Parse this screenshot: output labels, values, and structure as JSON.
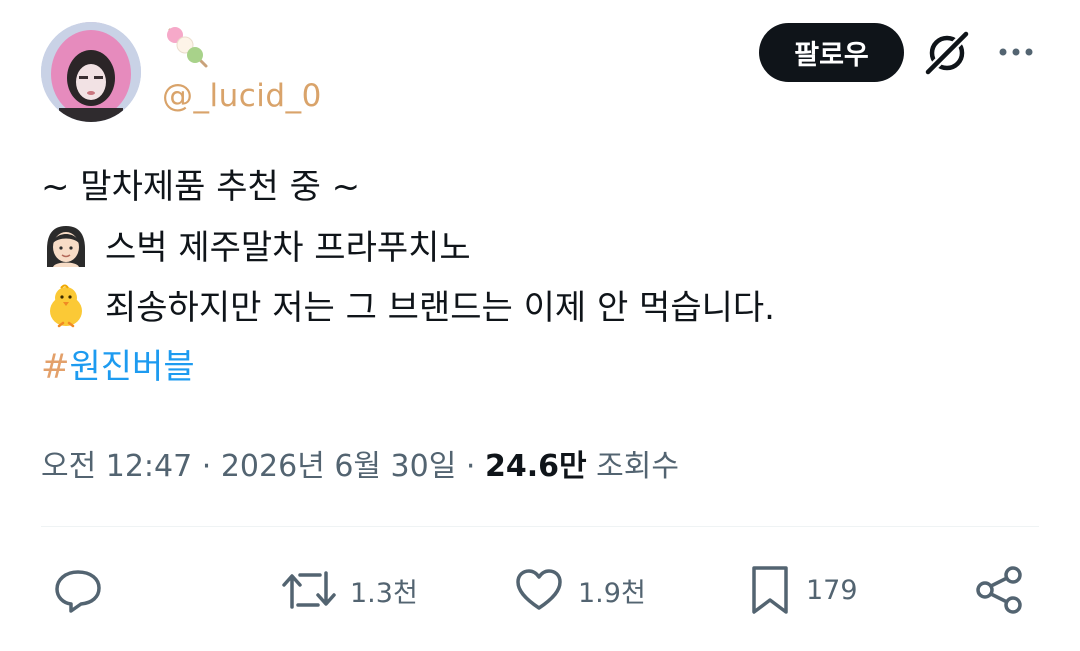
{
  "header": {
    "handle": "@_lucid_0",
    "follow_label": "팔로우",
    "name_emoji": "dango-icon"
  },
  "tweet": {
    "line1": "~ 말차제품 추천 중 ~",
    "line2": "스벅 제주말차 프라푸치노",
    "line3": "죄송하지만 저는 그 브랜드는 이제 안 먹습니다.",
    "hashtag_symbol": "#",
    "hashtag_text": "원진버블"
  },
  "meta": {
    "time": "오전 12:47",
    "separator": "·",
    "date": "2026년 6월 30일",
    "views_count": "24.6만",
    "views_label": "조회수"
  },
  "actions": {
    "retweets": "1.3천",
    "likes": "1.9천",
    "bookmarks": "179"
  },
  "colors": {
    "accent": "#1d9bf0",
    "handle": "#d9a36a",
    "muted": "#536471",
    "button": "#0f1419"
  }
}
